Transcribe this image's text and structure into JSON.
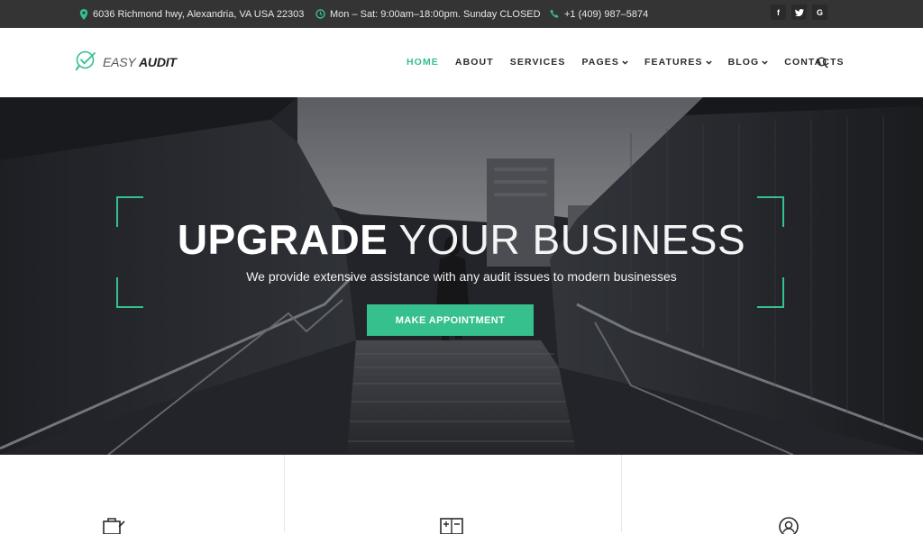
{
  "topbar": {
    "address": "6036 Richmond hwy, Alexandria, VA USA 22303",
    "hours": "Mon – Sat: 9:00am–18:00pm. Sunday CLOSED",
    "phone": "+1 (409) 987–5874",
    "socials": [
      {
        "icon": "facebook-icon",
        "glyph": "f"
      },
      {
        "icon": "twitter-icon",
        "glyph": "t"
      },
      {
        "icon": "google-icon",
        "glyph": "G"
      }
    ]
  },
  "logo": {
    "part1": "EASY",
    "part2": "AUDIT"
  },
  "nav": {
    "items": [
      {
        "label": "HOME",
        "active": true,
        "dropdown": false
      },
      {
        "label": "ABOUT",
        "active": false,
        "dropdown": false
      },
      {
        "label": "SERVICES",
        "active": false,
        "dropdown": false
      },
      {
        "label": "PAGES",
        "active": false,
        "dropdown": true
      },
      {
        "label": "FEATURES",
        "active": false,
        "dropdown": true
      },
      {
        "label": "BLOG",
        "active": false,
        "dropdown": true
      },
      {
        "label": "CONTACTS",
        "active": false,
        "dropdown": false
      }
    ]
  },
  "hero": {
    "title_bold": "UPGRADE",
    "title_light": "YOUR BUSINESS",
    "subtitle": "We provide extensive assistance with any audit issues to modern businesses",
    "cta_label": "MAKE APPOINTMENT"
  },
  "features": {
    "icons": [
      "briefcase-icon",
      "calculator-icon",
      "user-circle-icon"
    ]
  },
  "colors": {
    "accent": "#35c08e",
    "topbar_bg": "#343434",
    "text_dark": "#2b2b2b"
  }
}
